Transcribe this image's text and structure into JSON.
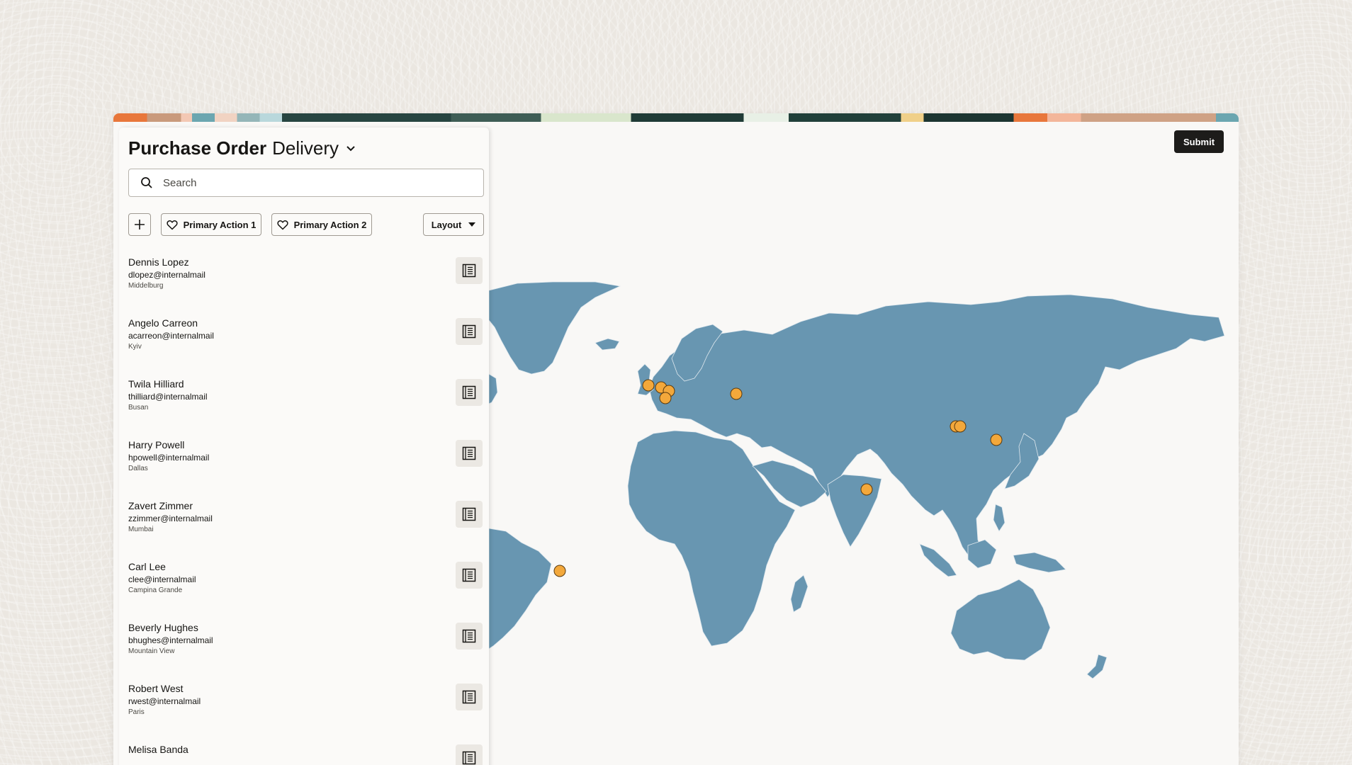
{
  "header": {
    "title_main": "Purchase Order",
    "title_sub": "Delivery"
  },
  "search": {
    "placeholder": "Search",
    "value": ""
  },
  "toolbar": {
    "primary_action_1": "Primary Action 1",
    "primary_action_2": "Primary Action 2",
    "layout": "Layout"
  },
  "submit_label": "Submit",
  "contacts": [
    {
      "name": "Dennis Lopez",
      "email": "dlopez@internalmail",
      "city": "Middelburg"
    },
    {
      "name": "Angelo Carreon",
      "email": "acarreon@internalmail",
      "city": "Kyiv"
    },
    {
      "name": "Twila Hilliard",
      "email": "thilliard@internalmail",
      "city": "Busan"
    },
    {
      "name": "Harry Powell",
      "email": "hpowell@internalmail",
      "city": "Dallas"
    },
    {
      "name": "Zavert Zimmer",
      "email": "zzimmer@internalmail",
      "city": "Mumbai"
    },
    {
      "name": "Carl Lee",
      "email": "clee@internalmail",
      "city": "Campina Grande"
    },
    {
      "name": "Beverly Hughes",
      "email": "bhughes@internalmail",
      "city": "Mountain View"
    },
    {
      "name": "Robert West",
      "email": "rwest@internalmail",
      "city": "Paris"
    },
    {
      "name": "Melisa Banda",
      "email": "",
      "city": ""
    }
  ],
  "colors": {
    "land": "#6896b1",
    "marker": "#f3a83b",
    "marker_stroke": "#5a3b10",
    "primary_button": "#1d1c1a"
  },
  "icons": {
    "search": "search-icon",
    "add": "plus-icon",
    "favorite": "heart-icon",
    "caret": "caret-down-icon",
    "detail": "detail-list-icon"
  }
}
